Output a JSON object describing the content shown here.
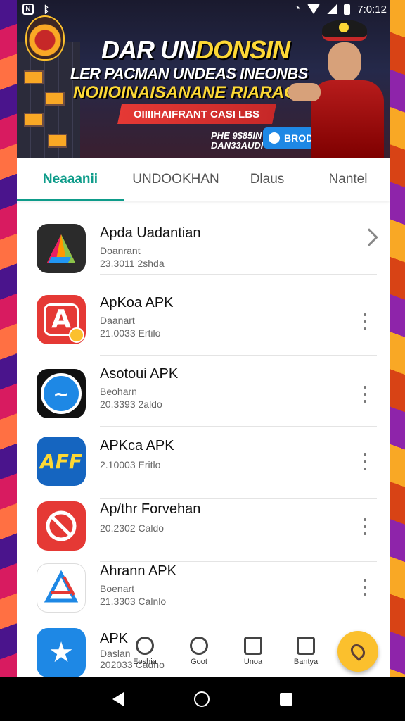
{
  "status": {
    "time": "7:0:12"
  },
  "banner": {
    "title_a": "DAR UN",
    "title_b": "DONSIN",
    "line1": "LER PACMAN UNDEAS INEONBS",
    "line2": "NOIIOINAISANANE RIARAG!",
    "red_strip": "OIIIIHAIFRANT CASI LBS",
    "small_text_1": "PHE 9$85IN",
    "small_text_2": "DAN33AUDI",
    "button_label": "BRODKN.ILLIUK"
  },
  "tabs": [
    {
      "label": "Neaaanii",
      "active": true
    },
    {
      "label": "UNDOOKHAN",
      "active": false
    },
    {
      "label": "Dlaus",
      "active": false
    },
    {
      "label": "Nantel",
      "active": false
    }
  ],
  "apps": [
    {
      "name": "Apda Uadantian",
      "sub": "Doanrant",
      "meta": "23.3011 2shda",
      "action": "chevron",
      "icon_name": "kolorful-k-icon",
      "icon_char": "K",
      "icon_bg": "#2b2b2b",
      "icon_fg": "#ff9800"
    },
    {
      "name": "ApKoa APK",
      "sub": "Daanart",
      "meta": "21.0033 Ertilo",
      "action": "menu",
      "icon_name": "apk-a-icon",
      "icon_char": "A",
      "icon_bg": "#e53935",
      "icon_fg": "#ffffff"
    },
    {
      "name": "Asotoui APK",
      "sub": "Beoharn",
      "meta": "20.3393 2aldo",
      "action": "menu",
      "icon_name": "shark-icon",
      "icon_char": "S",
      "icon_bg": "#111111",
      "icon_fg": "#29b6f6"
    },
    {
      "name": "APKca APK",
      "sub": "",
      "meta": "2.10003 Eritlo",
      "action": "menu",
      "icon_name": "aff-icon",
      "icon_char": "AFF",
      "icon_bg": "#1565c0",
      "icon_fg": "#fdd835"
    },
    {
      "name": "Ap/thr Forvehan",
      "sub": "",
      "meta": "20.2302 Caldo",
      "action": "menu",
      "icon_name": "prohibited-icon",
      "icon_char": "⦸",
      "icon_bg": "#e53935",
      "icon_fg": "#ffffff"
    },
    {
      "name": "Ahrann APK",
      "sub": "Boenart",
      "meta": "21.3303 Calnlo",
      "action": "menu",
      "icon_name": "triangle-a-icon",
      "icon_char": "A",
      "icon_bg": "#ffffff",
      "icon_fg": "#1e88e5"
    },
    {
      "name": "APK",
      "sub": "Daslan",
      "meta": "202033 Cadho",
      "action": "menu",
      "icon_name": "star-icon",
      "icon_char": "★",
      "icon_bg": "#1e88e5",
      "icon_fg": "#ffffff"
    }
  ],
  "bottom_nav": [
    {
      "label": "Eoshia",
      "icon": "search-icon"
    },
    {
      "label": "Goot",
      "icon": "refresh-icon"
    },
    {
      "label": "Unoa",
      "icon": "checkbox-icon"
    },
    {
      "label": "Bantya",
      "icon": "person-icon"
    }
  ]
}
